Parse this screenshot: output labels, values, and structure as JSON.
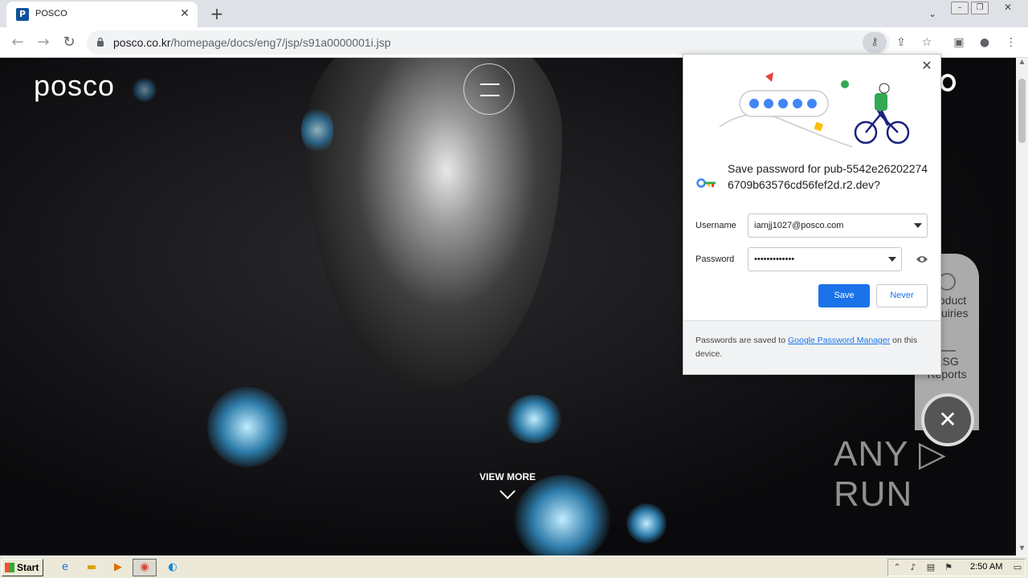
{
  "browser": {
    "tab_title": "POSCO",
    "tab_favicon_letter": "P",
    "url_host": "posco.co.kr",
    "url_path": "/homepage/docs/eng7/jsp/s91a0000001i.jsp"
  },
  "page": {
    "logo": "posco",
    "view_more": "VIEW MORE",
    "side_panel": {
      "items": [
        {
          "label": "Product Inquiries",
          "icon": "package-icon"
        },
        {
          "label": "ESG Reports",
          "icon": "sprout-icon"
        }
      ]
    },
    "watermark": "ANY ▷ RUN"
  },
  "password_bubble": {
    "title": "Save password for pub-5542e262022746709b63576cd56fef2d.r2.dev?",
    "username_label": "Username",
    "username_value": "iamjj1027@posco.com",
    "password_label": "Password",
    "password_value": "•••••••••••••",
    "save_label": "Save",
    "never_label": "Never",
    "footer_pre": "Passwords are saved to ",
    "footer_link": "Google Password Manager",
    "footer_post": " on this device."
  },
  "taskbar": {
    "start_label": "Start",
    "clock": "2:50 AM"
  },
  "colors": {
    "accent": "#1a73e8",
    "posco_blue": "#10529b"
  }
}
